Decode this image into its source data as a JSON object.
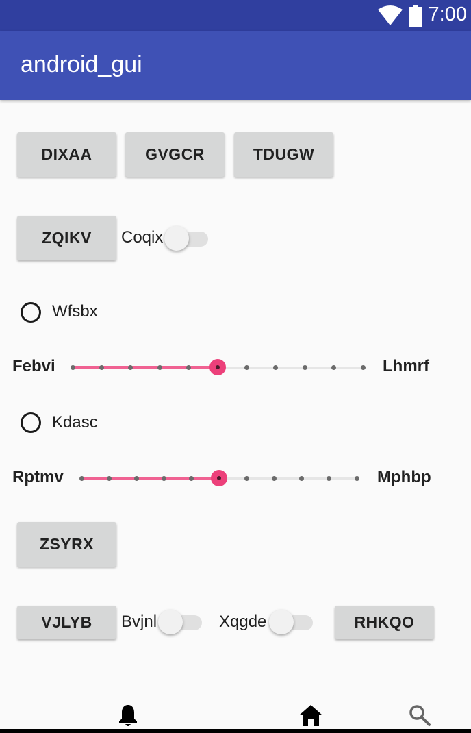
{
  "status_bar": {
    "time": "7:00",
    "icons": [
      "wifi-icon",
      "battery-icon"
    ]
  },
  "app_bar": {
    "title": "android_gui"
  },
  "buttons": {
    "b1": "DIXAA",
    "b2": "GVGCR",
    "b3": "TDUGW",
    "b4": "ZQIKV",
    "b5": "ZSYRX",
    "b6": "VJLYB",
    "b7": "RHKQO"
  },
  "switches": [
    {
      "label": "Coqix",
      "checked": false
    },
    {
      "label": "Bvjnl",
      "checked": false
    },
    {
      "label": "Xqgde",
      "checked": false
    }
  ],
  "radios": [
    {
      "label": "Wfsbx",
      "checked": false
    },
    {
      "label": "Kdasc",
      "checked": false
    }
  ],
  "seekbars": [
    {
      "left_label": "Febvi",
      "right_label": "Lhmrf",
      "max": 10,
      "value": 5
    },
    {
      "left_label": "Rptmv",
      "right_label": "Mphbp",
      "max": 10,
      "value": 5
    }
  ],
  "bottom_nav": [
    "bell-icon",
    "home-icon",
    "search-icon"
  ],
  "colors": {
    "status_bar": "#303f9f",
    "app_bar": "#3f51b5",
    "accent": "#ec407a"
  }
}
